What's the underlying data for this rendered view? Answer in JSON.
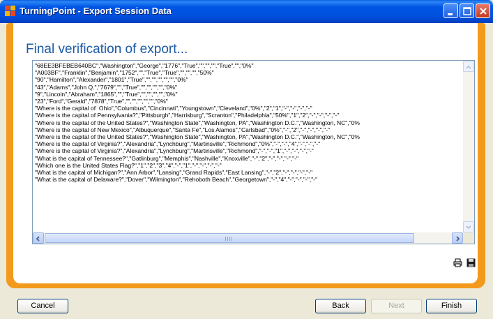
{
  "window": {
    "title": "TurningPoint - Export Session Data"
  },
  "main": {
    "heading": "Final verification of export...",
    "export_lines": [
      "\"68EE3BFEBEB640BC\",\"Washington\",\"George\",\"1776\",\"True\",\"\",\"\",\"\",\"True\",\"\",\"0%\"",
      "\"A003BF\",\"Franklin\",\"Benjamin\",\"1752\",\"\",\"True\",\"True\",\"\",\"\",\"\",\"50%\"",
      "\"90\",\"Hamilton\",\"Alexander\",\"1801\",\"True\",\"\",\"\",\"\",\"\",\"\",\"0%\"",
      "\"43\",\"Adams\",\"John Q.\",\"7679\",\"\",\"True\",\"\",\"\",\"\",\"\",\"0%\"",
      "\"9\",\"Lincoln\",\"Abraham\",\"1865\",\"\",\"True\",\"\",\"\",\"\",\"\",\"0%\"",
      "\"23\",\"Ford\",\"Gerald\",\"7878\",\"True\",\"\",\"\",\"\",\"\",\"\",\"0%\"",
      "\"Where is the capital of  Ohio\",\"Columbus\",\"Cincinnati\",\"Youngstown\",\"Cleveland\",\"0%\",\"2\",\"1\",\"-\",\"-\",\"-\",\"-\"",
      "\"Where is the capital of Pennsylvania?\",\"Pittsburgh\",\"Harrisburg\",\"Scranton\",\"Philadelphia\",\"50%\",\"1\",\"2\",\"-\",\"-\",\"-\",\"-\"",
      "\"Where is the capital of the United States?\",\"Washington State\",\"Washington, PA\",\"Washington D.C.\",\"Washington, NC\",\"0%",
      "\"Where is the capital of New Mexico\",\"Albuquerque\",\"Santa Fe\",\"Los Alamos\",\"Carlsbad\",\"0%\",\"-\",\"2\",\"-\",\"-\",\"-\",\"-\"",
      "\"Where is the capital of the United States?\",\"Washington State\",\"Washington, PA\",\"Washington D.C.\",\"Washington, NC\",\"0%",
      "\"Where is the capital of Virginia?\",\"Alexandria\",\"Lynchburg\",\"Martinsville\",\"Richmond\",\"0%\",\"-\",\"-\",\"4\",\"-\",\"-\",\"-\"",
      "\"Where is the capital of Virginia?\",\"Alexandria\",\"Lynchburg\",\"Martinsville\",\"Richmond\",\"-\",\"-\",\"1\",\"-\",\"-\",\"-\",\"-\"",
      "\"What is the capital of Tennessee?\",\"Gatlinburg\",\"Memphis\",\"Nashville\",\"Knoxville\",\"-\",\"2\",\"-\",\"-\",\"-\",\"-\"",
      "\"Which one is the United States Flag?\",\"1\",\"2\",\"3\",\"4\",\"-\",\"1\",\"-\",\"-\",\"-\",\"-\"",
      "\"What is the capital of Michigan?\",\"Ann Arbor\",\"Lansing\",\"Grand Rapids\",\"East Lansing\",\"-\",\"2\",\"-\",\"-\",\"-\",\"-\"",
      "\"What is the capital of Delaware?\",\"Dover\",\"Wilmington\",\"Rehoboth Beach\",\"Georgetown\",\"-\",\"4\",\"-\",\"-\",\"-\",\"-\""
    ],
    "icons": [
      "print-icon",
      "save-icon"
    ]
  },
  "footer": {
    "cancel_label": "Cancel",
    "back_label": "Back",
    "next_label": "Next",
    "finish_label": "Finish"
  },
  "colors": {
    "frame": "#f39a1d",
    "heading": "#1b5aa6",
    "titlebar": "#0055e5"
  }
}
